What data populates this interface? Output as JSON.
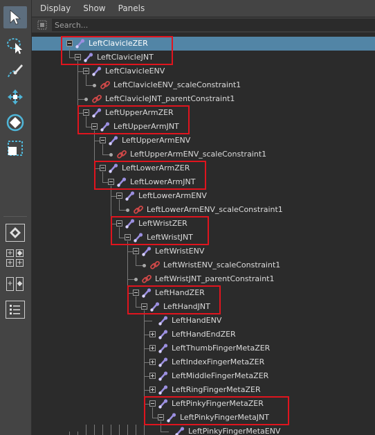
{
  "menu": {
    "items": [
      "Display",
      "Show",
      "Panels"
    ]
  },
  "search": {
    "placeholder": "Search..."
  },
  "tree": [
    {
      "label": "LeftClavicleZER",
      "depth": 0,
      "icon": "joint",
      "control": "minus",
      "selected": true
    },
    {
      "label": "LeftClavicleJNT",
      "depth": 1,
      "icon": "joint",
      "control": "minus"
    },
    {
      "label": "LeftClavicleENV",
      "depth": 2,
      "icon": "joint",
      "control": "minus"
    },
    {
      "label": "LeftClavicleENV_scaleConstraint1",
      "depth": 3,
      "icon": "constraint",
      "control": "dot"
    },
    {
      "label": "LeftClavicleJNT_parentConstraint1",
      "depth": 2,
      "icon": "constraint",
      "control": "dot"
    },
    {
      "label": "LeftUpperArmZER",
      "depth": 2,
      "icon": "joint",
      "control": "minus"
    },
    {
      "label": "LeftUpperArmJNT",
      "depth": 3,
      "icon": "joint",
      "control": "minus"
    },
    {
      "label": "LeftUpperArmENV",
      "depth": 4,
      "icon": "joint",
      "control": "minus"
    },
    {
      "label": "LeftUpperArmENV_scaleConstraint1",
      "depth": 5,
      "icon": "constraint",
      "control": "dot"
    },
    {
      "label": "LeftLowerArmZER",
      "depth": 4,
      "icon": "joint",
      "control": "minus"
    },
    {
      "label": "LeftLowerArmJNT",
      "depth": 5,
      "icon": "joint",
      "control": "minus"
    },
    {
      "label": "LeftLowerArmENV",
      "depth": 6,
      "icon": "joint",
      "control": "minus"
    },
    {
      "label": "LeftLowerArmENV_scaleConstraint1",
      "depth": 7,
      "icon": "constraint",
      "control": "dot"
    },
    {
      "label": "LeftWristZER",
      "depth": 6,
      "icon": "joint",
      "control": "minus"
    },
    {
      "label": "LeftWristJNT",
      "depth": 7,
      "icon": "joint",
      "control": "minus"
    },
    {
      "label": "LeftWristENV",
      "depth": 8,
      "icon": "joint",
      "control": "minus"
    },
    {
      "label": "LeftWristENV_scaleConstraint1",
      "depth": 9,
      "icon": "constraint",
      "control": "dot"
    },
    {
      "label": "LeftWristJNT_parentConstraint1",
      "depth": 8,
      "icon": "constraint",
      "control": "dot"
    },
    {
      "label": "LeftHandZER",
      "depth": 8,
      "icon": "joint",
      "control": "minus"
    },
    {
      "label": "LeftHandJNT",
      "depth": 9,
      "icon": "joint",
      "control": "minus"
    },
    {
      "label": "LeftHandENV",
      "depth": 10,
      "icon": "joint",
      "control": "none"
    },
    {
      "label": "LeftHandEndZER",
      "depth": 10,
      "icon": "joint",
      "control": "plus"
    },
    {
      "label": "LeftThumbFingerMetaZER",
      "depth": 10,
      "icon": "joint",
      "control": "plus"
    },
    {
      "label": "LeftIndexFingerMetaZER",
      "depth": 10,
      "icon": "joint",
      "control": "plus"
    },
    {
      "label": "LeftMiddleFingerMetaZER",
      "depth": 10,
      "icon": "joint",
      "control": "plus"
    },
    {
      "label": "LeftRingFingerMetaZER",
      "depth": 10,
      "icon": "joint",
      "control": "plus"
    },
    {
      "label": "LeftPinkyFingerMetaZER",
      "depth": 10,
      "icon": "joint",
      "control": "minus"
    },
    {
      "label": "LeftPinkyFingerMetaJNT",
      "depth": 11,
      "icon": "joint",
      "control": "minus"
    },
    {
      "label": "LeftPinkyFingerMetaENV",
      "depth": 12,
      "icon": "joint",
      "control": "none"
    }
  ],
  "highlights": [
    {
      "from": 0,
      "to": 1
    },
    {
      "from": 5,
      "to": 6
    },
    {
      "from": 9,
      "to": 10
    },
    {
      "from": 13,
      "to": 14
    },
    {
      "from": 18,
      "to": 19
    },
    {
      "from": 26,
      "to": 27
    }
  ],
  "colors": {
    "selection": "#5285a6",
    "highlight_box": "#e0141e",
    "joint_icon": "#9b8fe0",
    "constraint_icon": "#d04848"
  }
}
